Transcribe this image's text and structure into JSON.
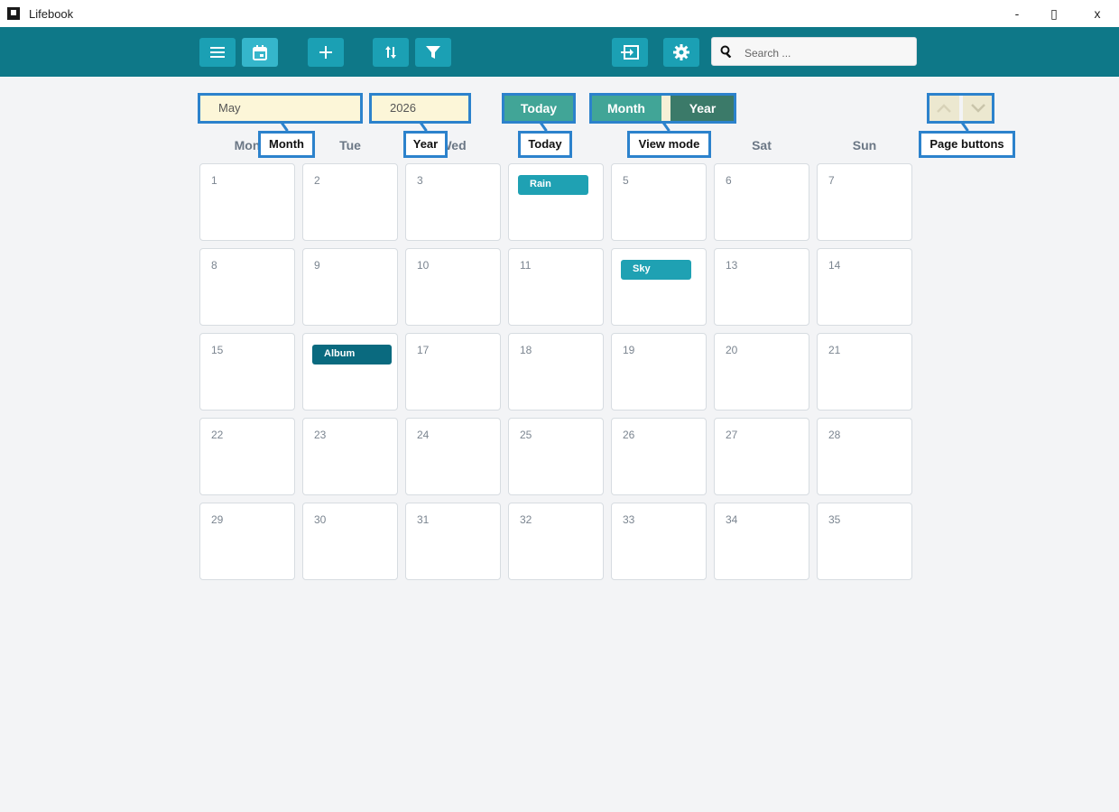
{
  "window": {
    "title": "Lifebook",
    "controls": {
      "minimize": "-",
      "maximize": "▯",
      "close": "x"
    }
  },
  "toolbar": {
    "buttons": [
      {
        "name": "menu",
        "icon": "menu-icon"
      },
      {
        "name": "calendar",
        "icon": "calendar-icon",
        "active": true
      },
      {
        "name": "add",
        "icon": "plus-icon"
      },
      {
        "name": "sort",
        "icon": "sort-icon"
      },
      {
        "name": "filter",
        "icon": "filter-icon"
      },
      {
        "name": "export",
        "icon": "export-icon"
      },
      {
        "name": "settings",
        "icon": "gear-icon"
      }
    ],
    "search": {
      "placeholder": "Search ...",
      "value": ""
    }
  },
  "controls": {
    "month": "May",
    "year": "2026",
    "today_label": "Today",
    "view_mode": {
      "options": [
        "Month",
        "Year"
      ],
      "selected": "Year"
    }
  },
  "callouts": {
    "month": "Month",
    "year": "Year",
    "today": "Today",
    "view_mode": "View mode",
    "page_buttons": "Page buttons"
  },
  "weekdays": [
    "Mon",
    "Tue",
    "Wed",
    "Thu",
    "Fri",
    "Sat",
    "Sun"
  ],
  "days": [
    "1",
    "2",
    "3",
    "4",
    "5",
    "6",
    "7",
    "8",
    "9",
    "10",
    "11",
    "12",
    "13",
    "14",
    "15",
    "16",
    "17",
    "18",
    "19",
    "20",
    "21",
    "22",
    "23",
    "24",
    "25",
    "26",
    "27",
    "28",
    "29",
    "30",
    "31",
    "32",
    "33",
    "34",
    "35"
  ],
  "events": [
    {
      "day": 4,
      "label": "Rain",
      "color": "#1fa1b3"
    },
    {
      "day": 12,
      "label": "Sky",
      "color": "#1fa1b3"
    },
    {
      "day": 16,
      "label": "Album",
      "color": "#0a6a7f"
    }
  ],
  "colors": {
    "toolbar": "#0e7888",
    "button": "#1ba0b4",
    "accent_green": "#41a597",
    "selected_year": "#3b7a69",
    "field_bg": "#fcf6d8",
    "callout_border": "#2c82cc"
  }
}
